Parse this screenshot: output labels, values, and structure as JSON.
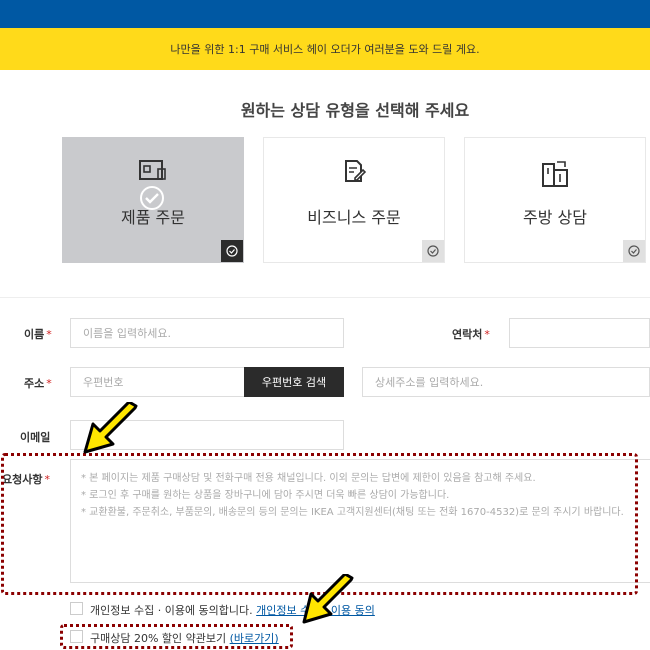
{
  "banner": {
    "text": "나만을 위한 1:1 구매 서비스 헤이 오더가 여러분을 도와 드릴 게요."
  },
  "heading": "원하는 상담 유형을 선택해 주세요",
  "cards": [
    {
      "label": "제품 주문",
      "icon": "store-icon",
      "selected": true
    },
    {
      "label": "비즈니스 주문",
      "icon": "edit-document-icon",
      "selected": false
    },
    {
      "label": "주방 상담",
      "icon": "kitchen-icon",
      "selected": false
    }
  ],
  "form": {
    "name_label": "이름",
    "name_placeholder": "이름을 입력하세요.",
    "contact_label": "연락처",
    "address_label": "주소",
    "zipcode_placeholder": "우편번호",
    "zipcode_button": "우편번호 검색",
    "detail_address_placeholder": "상세주소를 입력하세요.",
    "email_label": "이메일",
    "request_label": "요청사항",
    "request_lines": [
      "* 본 페이지는 제품 구매상담 및 전화구매 전용 채널입니다. 이외 문의는 답변에 제한이 있음을 참고해 주세요.",
      "* 로그인 후 구매를 원하는 상품을 장바구니에 담아 주시면 더욱 빠른 상담이 가능합니다.",
      "* 교환환불, 주문취소, 부품문의, 배송문의 등의 문의는 IKEA 고객지원센터(채팅 또는 전화 1670-4532)로 문의 주시기 바랍니다."
    ],
    "required_mark": "*"
  },
  "consents": {
    "privacy_text": "개인정보 수집 · 이용에 동의합니다.",
    "privacy_link": "개인정보 수집 · 이용 동의",
    "discount_text": "구매상담 20% 할인 약관보기",
    "discount_link": "(바로가기)"
  },
  "colors": {
    "top_bar": "#0058a3",
    "banner": "#ffda1a",
    "annotation": "#8b0000",
    "arrow": "#ffe600"
  }
}
